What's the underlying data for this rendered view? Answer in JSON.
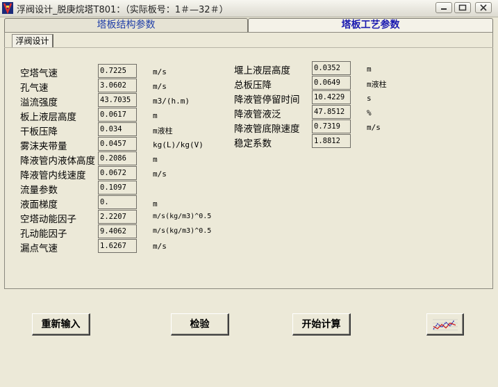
{
  "window": {
    "title": "浮阀设计_脱庚烷塔T801：（实际板号：1＃—32＃）"
  },
  "tabs": [
    {
      "label": "塔板结构参数",
      "active": false
    },
    {
      "label": "塔板工艺参数",
      "active": true
    }
  ],
  "subtab": {
    "label": "浮阀设计"
  },
  "left_params": [
    {
      "label": "空塔气速",
      "value": "0.7225",
      "unit": "m/s"
    },
    {
      "label": "孔气速",
      "value": "3.0602",
      "unit": "m/s"
    },
    {
      "label": "溢流强度",
      "value": "43.7035",
      "unit": "m3/(h.m)"
    },
    {
      "label": "板上液层高度",
      "value": "0.0617",
      "unit": "m"
    },
    {
      "label": "干板压降",
      "value": "0.034",
      "unit": "m液柱"
    },
    {
      "label": "雾沫夹带量",
      "value": "0.0457",
      "unit": "kg(L)/kg(V)"
    },
    {
      "label": "降液管内液体高度",
      "value": "0.2086",
      "unit": "m"
    },
    {
      "label": "降液管内线速度",
      "value": "0.0672",
      "unit": "m/s"
    },
    {
      "label": "流量参数",
      "value": "0.1097",
      "unit": ""
    },
    {
      "label": "液面梯度",
      "value": "0.",
      "unit": "m"
    },
    {
      "label": "空塔动能因子",
      "value": "2.2207",
      "unit": "m/s(kg/m3)^0.5"
    },
    {
      "label": "孔动能因子",
      "value": "9.4062",
      "unit": "m/s(kg/m3)^0.5"
    },
    {
      "label": "漏点气速",
      "value": "1.6267",
      "unit": "m/s"
    }
  ],
  "right_params": [
    {
      "label": "堰上液层高度",
      "value": "0.0352",
      "unit": "m"
    },
    {
      "label": "总板压降",
      "value": "0.0649",
      "unit": "m液柱"
    },
    {
      "label": "降液管停留时间",
      "value": "10.4229",
      "unit": "s"
    },
    {
      "label": "降液管液泛",
      "value": "47.8512",
      "unit": "%"
    },
    {
      "label": "降液管底隙速度",
      "value": "0.7319",
      "unit": "m/s"
    },
    {
      "label": "稳定系数",
      "value": "1.8812",
      "unit": ""
    }
  ],
  "buttons": {
    "reset": "重新输入",
    "check": "检验",
    "calculate": "开始计算",
    "chart_icon": "line-chart-icon"
  }
}
